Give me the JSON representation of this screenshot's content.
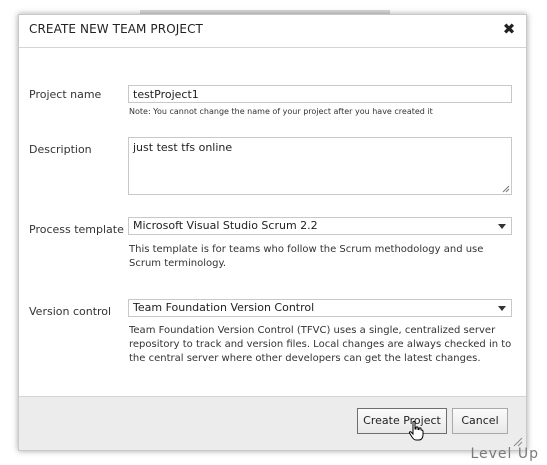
{
  "dialog": {
    "title": "CREATE NEW TEAM PROJECT",
    "close_symbol": "✖"
  },
  "form": {
    "project_name": {
      "label": "Project name",
      "value": "testProject1",
      "note": "Note: You cannot change the name of your project after you have created it"
    },
    "description": {
      "label": "Description",
      "value": "just test tfs online"
    },
    "process_template": {
      "label": "Process template",
      "selected": "Microsoft Visual Studio Scrum 2.2",
      "help": "This template is for teams who follow the Scrum methodology and use Scrum terminology."
    },
    "version_control": {
      "label": "Version control",
      "selected": "Team Foundation Version Control",
      "help": "Team Foundation Version Control (TFVC) uses a single, centralized server repository to track and version files. Local changes are always checked in to the central server where other developers can get the latest changes."
    }
  },
  "footer": {
    "create_label": "Create Project",
    "cancel_label": "Cancel"
  },
  "watermark": "Level Up",
  "icons": {
    "close": "close-icon",
    "dropdown": "chevron-down-icon",
    "cursor": "hand-pointer-icon",
    "resize": "resize-grip-icon"
  }
}
